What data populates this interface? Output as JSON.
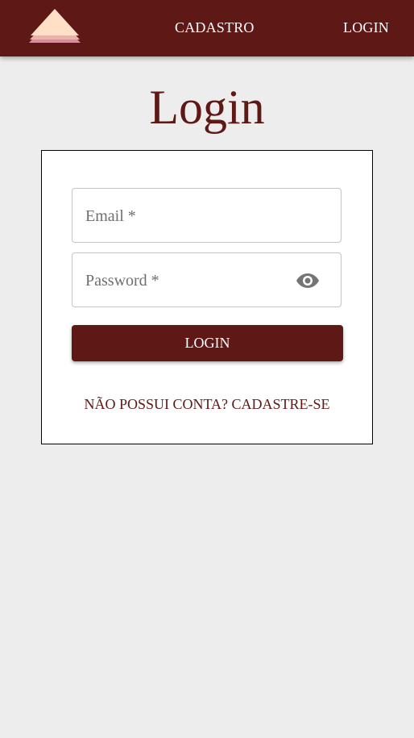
{
  "nav": {
    "logo_icon": "layered-triangle-logo-icon",
    "links": [
      "CADASTRO",
      "LOGIN"
    ]
  },
  "page": {
    "title": "Login"
  },
  "form": {
    "email_label": "Email *",
    "password_label": "Password *",
    "password_toggle_icon": "eye-icon",
    "submit_label": "LOGIN",
    "signup_link": "NÃO POSSUI CONTA? CADASTRE-SE"
  },
  "colors": {
    "primary": "#5e1816",
    "background": "#ededed",
    "card": "#ffffff",
    "logo_light": "#ffe0c6",
    "logo_pink": "#d98b9f",
    "logo_mid": "#e9b3a8"
  }
}
